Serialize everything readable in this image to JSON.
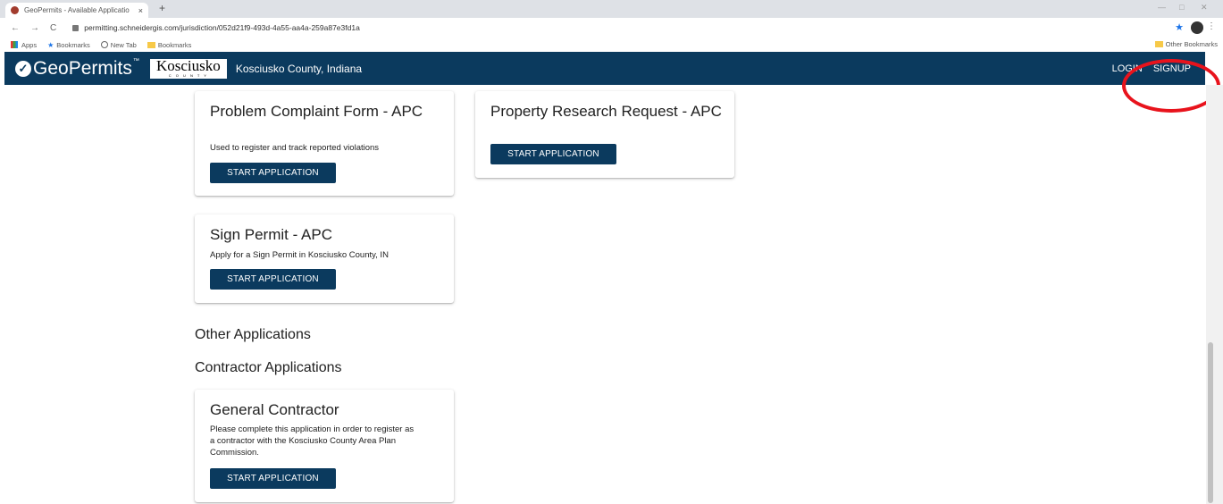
{
  "browser": {
    "tab_title": "GeoPermits - Available Applicatio",
    "tab_close": "×",
    "new_tab": "+",
    "url": "permitting.schneidergis.com/jurisdiction/052d21f9-493d-4a55-aa4a-259a87e3fd1a",
    "bookmarks": [
      "Apps",
      "Bookmarks",
      "New Tab",
      "Bookmarks"
    ],
    "other_bookmarks": "Other Bookmarks"
  },
  "header": {
    "brand": "GeoPermits",
    "brand_tm": "™",
    "county_logo_word": "Kosciusko",
    "county_logo_sub": "C O U N T Y",
    "county_name": "Kosciusko County, Indiana",
    "login": "LOGIN",
    "signup": "SIGNUP"
  },
  "cards": [
    {
      "title": "Problem Complaint Form - APC",
      "description": "Used to register and track reported violations",
      "button": "START APPLICATION"
    },
    {
      "title": "Property Research Request - APC",
      "description": "",
      "button": "START APPLICATION"
    },
    {
      "title": "Sign Permit - APC",
      "description": "Apply for a Sign Permit in Kosciusko County, IN",
      "button": "START APPLICATION"
    },
    {
      "title": "General Contractor",
      "description": "Please complete this application in order to register as a contractor with the Kosciusko County Area Plan Commission.",
      "button": "START APPLICATION"
    }
  ],
  "sections": {
    "other": "Other Applications",
    "contractor": "Contractor Applications"
  },
  "colors": {
    "header_bg": "#0b3a5e",
    "button_bg": "#0b3a5e",
    "highlight_circle": "#e8131c"
  }
}
